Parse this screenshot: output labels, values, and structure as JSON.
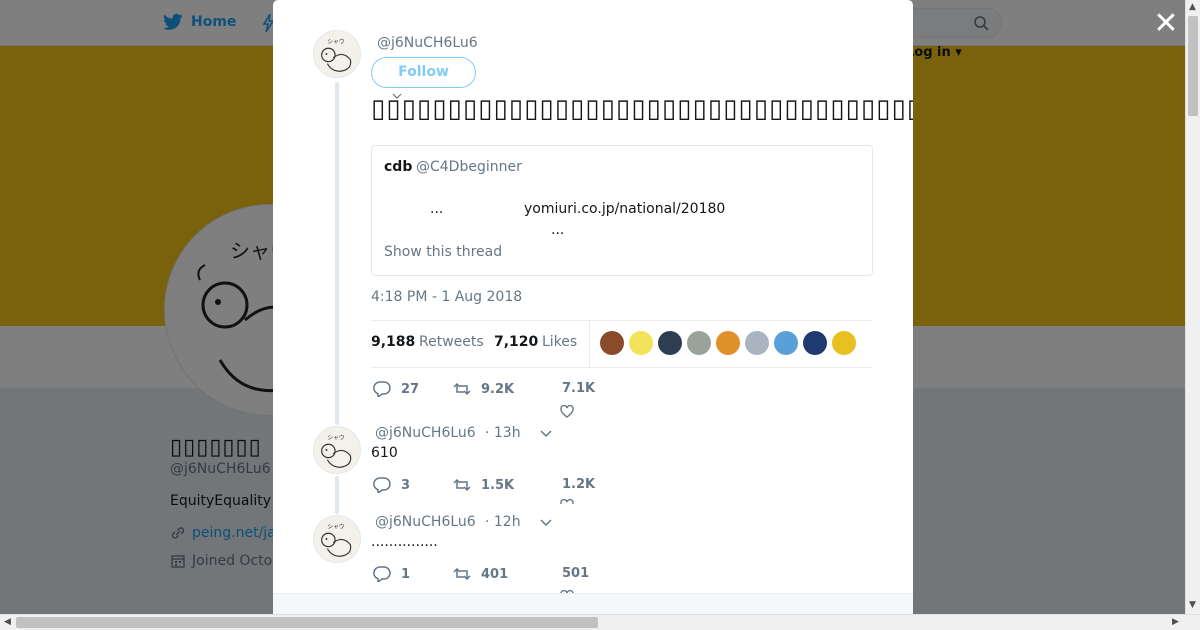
{
  "background": {
    "nav": {
      "home_label": "Home",
      "login_label": "Log in"
    },
    "profile": {
      "name": "▯▯▯▯▯▯▯",
      "handle": "@j6NuCH6Lu6",
      "bio": "EquityEquality",
      "link": "peing.net/ja",
      "joined": "Joined Octo"
    },
    "colors": {
      "banner": "#f5c518",
      "accent": "#1da1f2"
    }
  },
  "modal": {
    "main_tweet": {
      "handle": "@j6NuCH6Lu6",
      "follow_label": "Follow",
      "text": "▯▯▯▯▯▯▯▯▯▯▯▯▯▯▯▯▯▯▯▯▯▯▯▯▯▯▯▯▯▯▯▯▯▯▯▯▯▯▯▯▯▯▯▯▯▯▯▯▯",
      "quote": {
        "name": "cdb",
        "handle": "@C4Dbeginner",
        "dots1": "...",
        "link": "yomiuri.co.jp/national/20180",
        "dots2": "...",
        "show_thread": "Show this thread"
      },
      "timestamp": "4:18 PM - 1 Aug 2018",
      "retweets_count": "9,188",
      "retweets_label": "Retweets",
      "likes_count": "7,120",
      "likes_label": "Likes",
      "liker_colors": [
        "#8a4b2a",
        "#f2e35a",
        "#2c3e50",
        "#9aa39a",
        "#e0902a",
        "#aab4c0",
        "#5aa0d8",
        "#1f3a6e",
        "#e8c020"
      ],
      "actions": {
        "replies": "27",
        "retweets": "9.2K",
        "likes": "7.1K"
      }
    },
    "replies": [
      {
        "handle": "@j6NuCH6Lu6",
        "time": "· 13h",
        "text": "610",
        "replies": "3",
        "retweets": "1.5K",
        "likes": "1.2K"
      },
      {
        "handle": "@j6NuCH6Lu6",
        "time": "· 12h",
        "text": "...............",
        "replies": "1",
        "retweets": "401",
        "likes": "501"
      }
    ]
  }
}
